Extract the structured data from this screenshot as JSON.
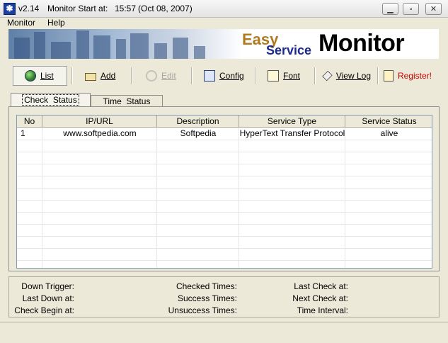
{
  "titlebar": {
    "version": "v2.14",
    "start_label": "Monitor Start at:",
    "start_time": "15:57",
    "start_date": "(Oct 08, 2007)"
  },
  "menu": [
    "Monitor",
    "Help"
  ],
  "banner": {
    "easy": "Easy",
    "service": "Service",
    "monitor": "Monitor"
  },
  "toolbar": {
    "list": "List",
    "add": "Add",
    "edit": "Edit",
    "config": "Config",
    "font": "Font",
    "view_log": "View Log",
    "register": "Register!"
  },
  "tabs": [
    "Check  Status",
    "Time  Status"
  ],
  "table": {
    "columns": [
      "No",
      "IP/URL",
      "Description",
      "Service Type",
      "Service Status"
    ],
    "rows": [
      [
        "1",
        "www.softpedia.com",
        "Softpedia",
        "HyperText Transfer Protocol",
        "alive"
      ]
    ]
  },
  "status": {
    "down_trigger": "Down Trigger:",
    "last_down_at": "Last Down at:",
    "check_begin_at": "Check Begin at:",
    "checked_times": "Checked Times:",
    "success_times": "Success Times:",
    "unsuccess_times": "Unsuccess Times:",
    "last_check_at": "Last Check at:",
    "next_check_at": "Next Check at:",
    "time_interval": "Time Interval:"
  },
  "colors": {
    "register": "#cc0000",
    "brand_easy": "#b07a1f",
    "brand_service": "#1b2a8c"
  }
}
